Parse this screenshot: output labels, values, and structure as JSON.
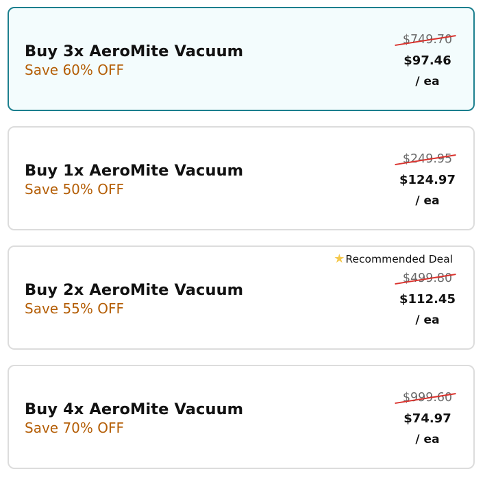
{
  "offers": [
    {
      "title": "Buy 3x AeroMite Vacuum",
      "savings": "Save 60% OFF",
      "original_price": "$749.70",
      "price": "$97.46",
      "unit": "/ ea",
      "selected": true
    },
    {
      "title": "Buy 1x AeroMite Vacuum",
      "savings": "Save 50% OFF",
      "original_price": "$249.95",
      "price": "$124.97",
      "unit": "/ ea",
      "selected": false
    },
    {
      "title": "Buy 2x AeroMite Vacuum",
      "savings": "Save 55% OFF",
      "original_price": "$499.80",
      "price": "$112.45",
      "unit": "/ ea",
      "selected": false,
      "badge": "Recommended Deal",
      "badge_icon": "star-icon"
    },
    {
      "title": "Buy 4x AeroMite Vacuum",
      "savings": "Save 70% OFF",
      "original_price": "$999.60",
      "price": "$74.97",
      "unit": "/ ea",
      "selected": false
    }
  ],
  "colors": {
    "selected_border": "#1b7f8e",
    "selected_background": "#f3fcfd",
    "card_border": "#dcdcdc",
    "savings_text": "#b45e06",
    "strikethrough": "#d9322d",
    "star": "#f5c84b"
  }
}
